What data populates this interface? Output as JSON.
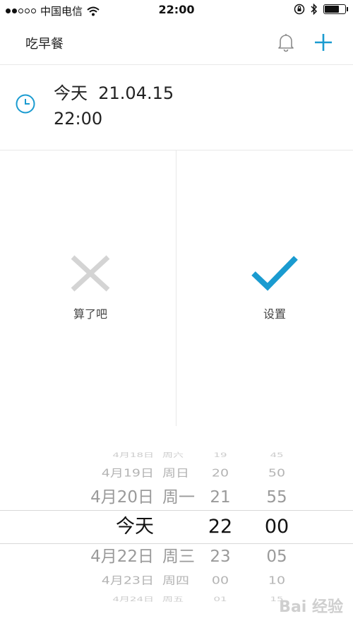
{
  "status_bar": {
    "carrier": "中国电信",
    "time": "22:00",
    "battery_level": 0.7,
    "signal_bars_filled": 2,
    "signal_bars_total": 5
  },
  "nav": {
    "title": "吃早餐"
  },
  "reminder": {
    "date": "今天  21.04.15",
    "time": "22:00"
  },
  "actions": {
    "cancel_label": "算了吧",
    "confirm_label": "设置"
  },
  "picker": {
    "rows": [
      {
        "date": "4月18日",
        "weekday": "周六",
        "hour": "19",
        "minute": "45"
      },
      {
        "date": "4月19日",
        "weekday": "周日",
        "hour": "20",
        "minute": "50"
      },
      {
        "date": "4月20日",
        "weekday": "周一",
        "hour": "21",
        "minute": "55"
      },
      {
        "date": "今天",
        "weekday": "",
        "hour": "22",
        "minute": "00"
      },
      {
        "date": "4月22日",
        "weekday": "周三",
        "hour": "23",
        "minute": "05"
      },
      {
        "date": "4月23日",
        "weekday": "周四",
        "hour": "00",
        "minute": "10"
      },
      {
        "date": "4月24日",
        "weekday": "周五",
        "hour": "01",
        "minute": "15"
      }
    ],
    "selected_index": 3
  },
  "watermark": "Bai 经验",
  "colors": {
    "accent": "#1a9bd0",
    "cancel_gray": "#d4d4d4",
    "divider": "#e8e8e8"
  }
}
